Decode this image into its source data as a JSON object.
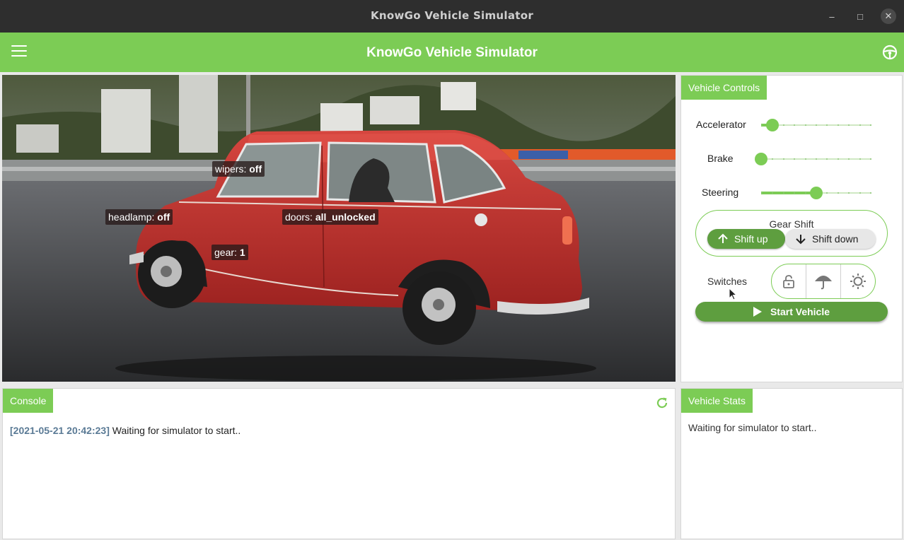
{
  "window": {
    "title": "KnowGo Vehicle Simulator",
    "minimize_glyph": "–",
    "maximize_glyph": "□",
    "close_glyph": "✕"
  },
  "appbar": {
    "title": "KnowGo Vehicle Simulator",
    "menu_icon": "hamburger-menu-icon",
    "right_icon": "steering-wheel-icon"
  },
  "scene": {
    "tags": {
      "wipers": {
        "key": "wipers:",
        "value": "off"
      },
      "headlamp": {
        "key": "headlamp:",
        "value": "off"
      },
      "doors": {
        "key": "doors:",
        "value": "all_unlocked"
      },
      "gear": {
        "key": "gear:",
        "value": "1"
      }
    }
  },
  "controls": {
    "header": "Vehicle Controls",
    "accelerator": {
      "label": "Accelerator",
      "value_fraction": 0.1
    },
    "brake": {
      "label": "Brake",
      "value_fraction": 0.0
    },
    "steering": {
      "label": "Steering",
      "value_fraction": 0.5
    },
    "gear_shift": {
      "title": "Gear Shift",
      "up_label": "Shift up",
      "down_label": "Shift down"
    },
    "switches": {
      "label": "Switches",
      "icons": [
        "lock-open-icon",
        "umbrella-icon",
        "headlamp-icon"
      ]
    },
    "start_label": "Start Vehicle"
  },
  "console": {
    "header": "Console",
    "timestamp": "[2021-05-21 20:42:23]",
    "message": "Waiting for simulator to start.."
  },
  "stats": {
    "header": "Vehicle Stats",
    "message": "Waiting for simulator to start.."
  },
  "colors": {
    "accent": "#7ccc55",
    "accent_dark": "#5e9e3f",
    "titlebar": "#2e2e2e",
    "car": "#c8322e"
  }
}
